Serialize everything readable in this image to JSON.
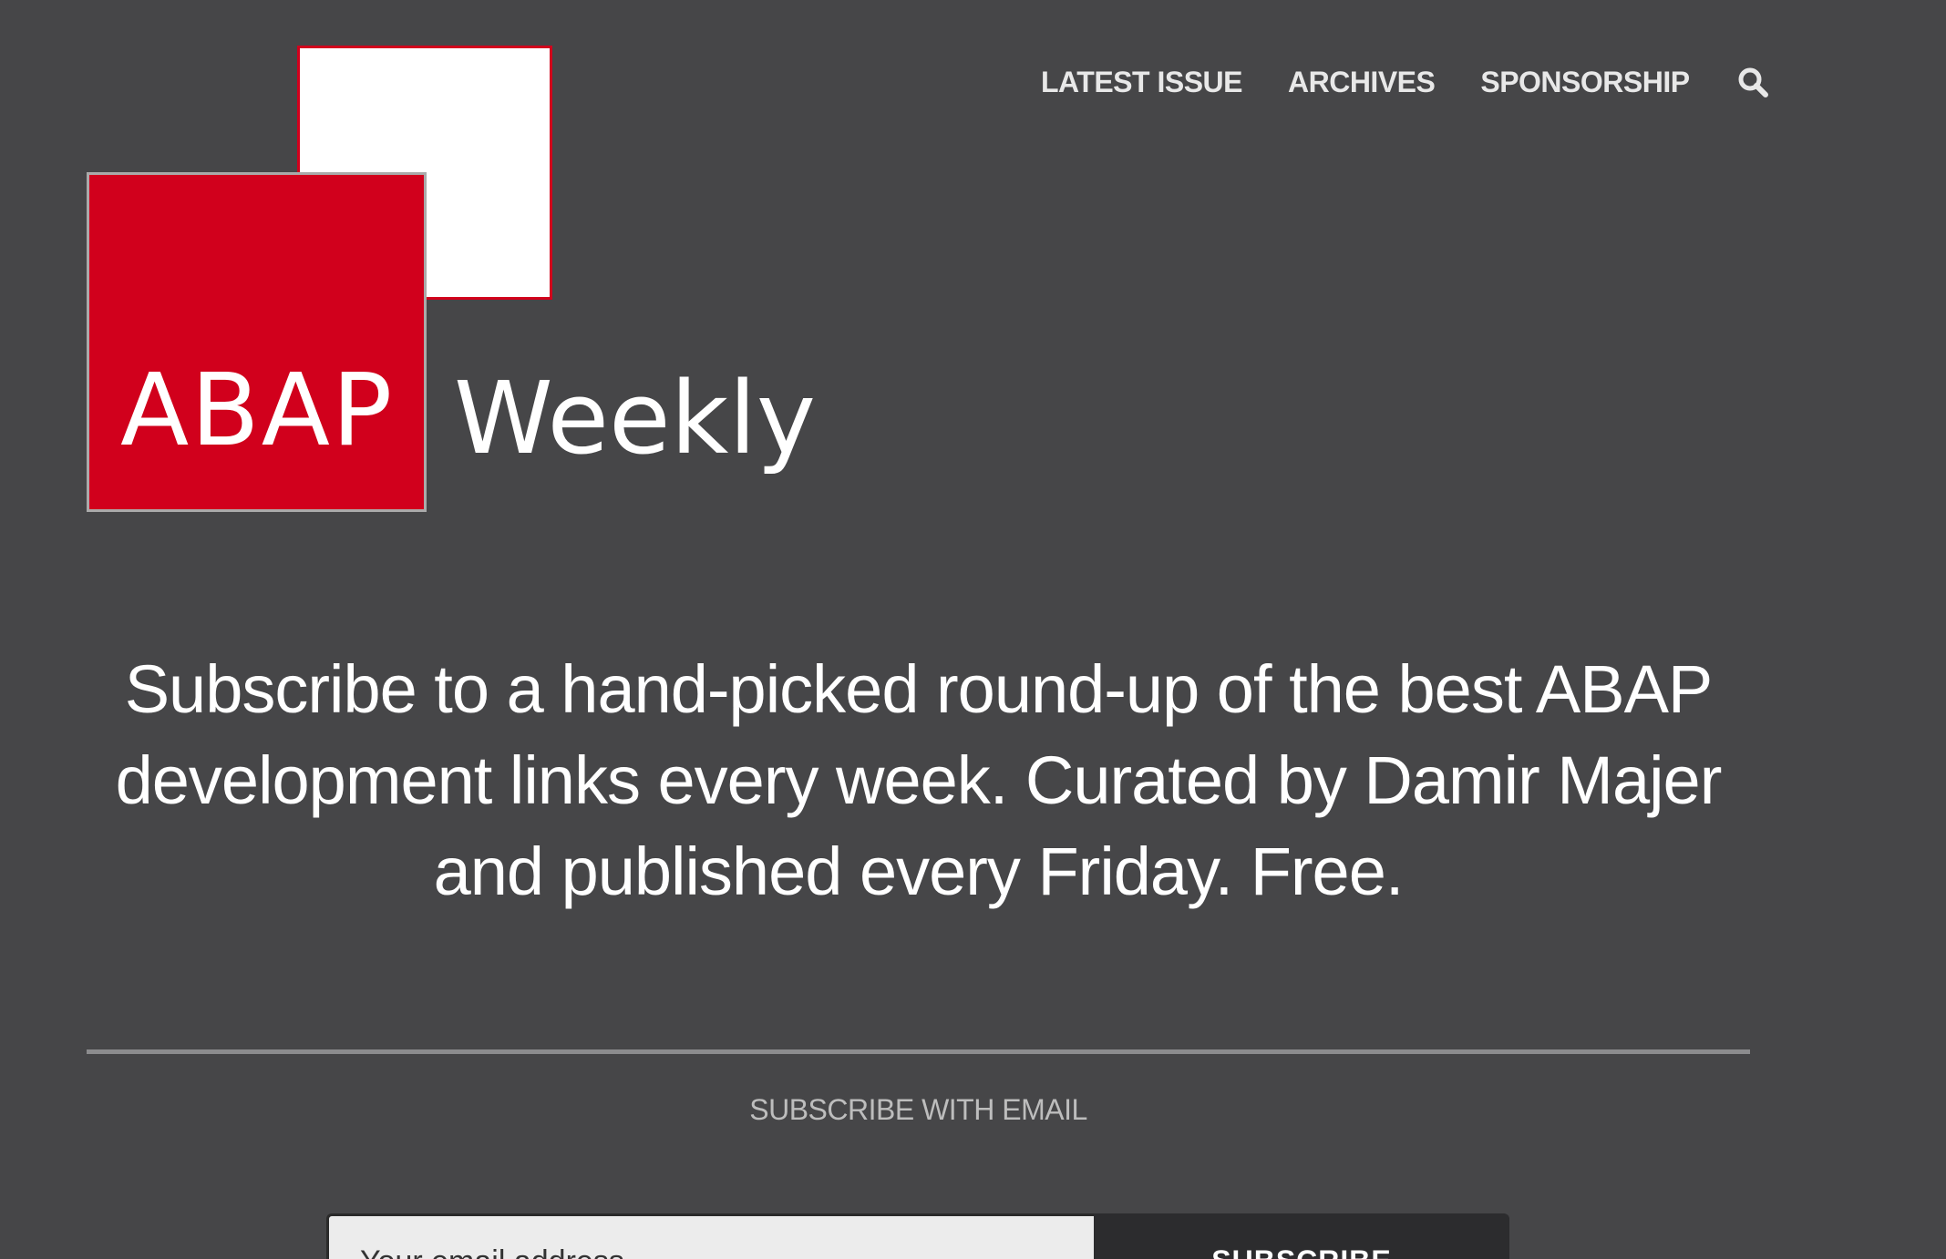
{
  "nav": {
    "items": [
      {
        "label": "LATEST ISSUE"
      },
      {
        "label": "ARCHIVES"
      },
      {
        "label": "SPONSORSHIP"
      }
    ],
    "search_icon": "search-icon"
  },
  "logo": {
    "primary": "ABAP",
    "secondary": "Weekly",
    "colors": {
      "red": "#d1001c",
      "white": "#ffffff"
    }
  },
  "hero": {
    "tagline": "Subscribe to a hand-picked round-up of the best ABAP development links every week. Curated by Damir Majer and published every Friday. Free."
  },
  "subscribe": {
    "heading": "SUBSCRIBE WITH EMAIL",
    "email_placeholder": "Your email address",
    "button_label": "SUBSCRIBE"
  },
  "theme": {
    "background": "#464648",
    "text": "#ffffff",
    "divider": "#8c8c8e"
  }
}
